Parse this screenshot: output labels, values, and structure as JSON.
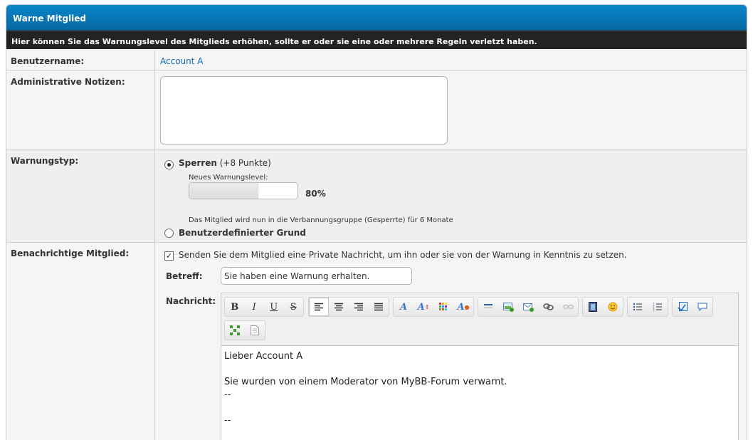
{
  "header": {
    "title": "Warne Mitglied"
  },
  "subheader": {
    "text": "Hier können Sie das Warnungslevel des Mitglieds erhöhen, sollte er oder sie eine oder mehrere Regeln verletzt haben."
  },
  "fields": {
    "username_label": "Benutzername:",
    "username_value": "Account A",
    "notes_label": "Administrative Notizen:",
    "notes_value": "",
    "warning_type_label": "Warnungstyp:",
    "notify_label": "Benachrichtige Mitglied:"
  },
  "warning_types": [
    {
      "name": "Sperren",
      "points": "(+8 Punkte)",
      "selected": true
    },
    {
      "name": "Benutzerdefinierter Grund",
      "selected": false
    }
  ],
  "level": {
    "label": "Neues Warnungslevel:",
    "percent_text": "80%",
    "fill_fraction": 0.8,
    "note": "Das Mitglied wird nun in die Verbannungsgruppe (Gesperrte) für 6 Monate"
  },
  "notify": {
    "checked": true,
    "text": "Senden Sie dem Mitglied eine Private Nachricht, um ihn oder sie von der Warnung in Kenntnis zu setzen.",
    "subject_label": "Betreff:",
    "subject_value": "Sie haben eine Warnung erhalten.",
    "message_label": "Nachricht:",
    "message_lines": [
      "Lieber Account A",
      "",
      "Sie wurden von einem Moderator von MyBB-Forum verwarnt.",
      "--",
      "",
      "--"
    ]
  },
  "toolbar_icons": {
    "bold": "B",
    "italic": "I",
    "underline": "U",
    "strike": "S"
  },
  "colors": {
    "header_blue": "#0a86c8",
    "subheader_dark": "#232323",
    "link_blue": "#0f6fa8"
  }
}
